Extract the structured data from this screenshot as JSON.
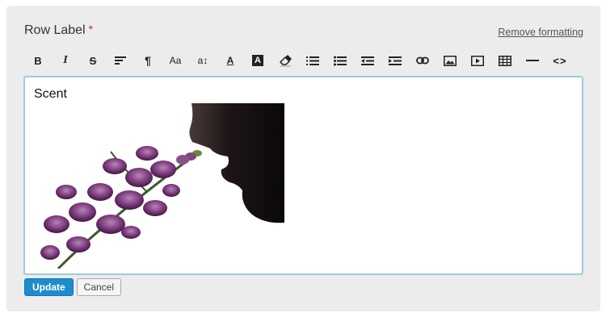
{
  "field": {
    "label": "Row Label",
    "required_mark": "*"
  },
  "toolbar": {
    "remove_formatting": "Remove formatting",
    "buttons": [
      {
        "name": "bold-icon",
        "glyph": "B"
      },
      {
        "name": "italic-icon",
        "glyph": "I"
      },
      {
        "name": "strikethrough-icon",
        "glyph": "S"
      },
      {
        "name": "align-icon",
        "glyph": ""
      },
      {
        "name": "paragraph-icon",
        "glyph": "¶"
      },
      {
        "name": "font-family-icon",
        "glyph": "Aa"
      },
      {
        "name": "font-size-icon",
        "glyph": "a↕"
      },
      {
        "name": "text-color-icon",
        "glyph": "A"
      },
      {
        "name": "background-color-icon",
        "glyph": "A"
      },
      {
        "name": "eraser-icon",
        "glyph": ""
      },
      {
        "name": "ordered-list-icon",
        "glyph": ""
      },
      {
        "name": "unordered-list-icon",
        "glyph": ""
      },
      {
        "name": "outdent-icon",
        "glyph": ""
      },
      {
        "name": "indent-icon",
        "glyph": ""
      },
      {
        "name": "link-icon",
        "glyph": ""
      },
      {
        "name": "image-icon",
        "glyph": ""
      },
      {
        "name": "video-icon",
        "glyph": ""
      },
      {
        "name": "table-icon",
        "glyph": ""
      },
      {
        "name": "horizontal-rule-icon",
        "glyph": ""
      },
      {
        "name": "code-view-icon",
        "glyph": "<>"
      }
    ]
  },
  "editor": {
    "text": "Scent"
  },
  "actions": {
    "update": "Update",
    "cancel": "Cancel"
  },
  "colors": {
    "primary": "#1e8ccc",
    "required": "#cc1f1f",
    "editor_border": "#9ccbd8",
    "panel": "#ececec"
  }
}
